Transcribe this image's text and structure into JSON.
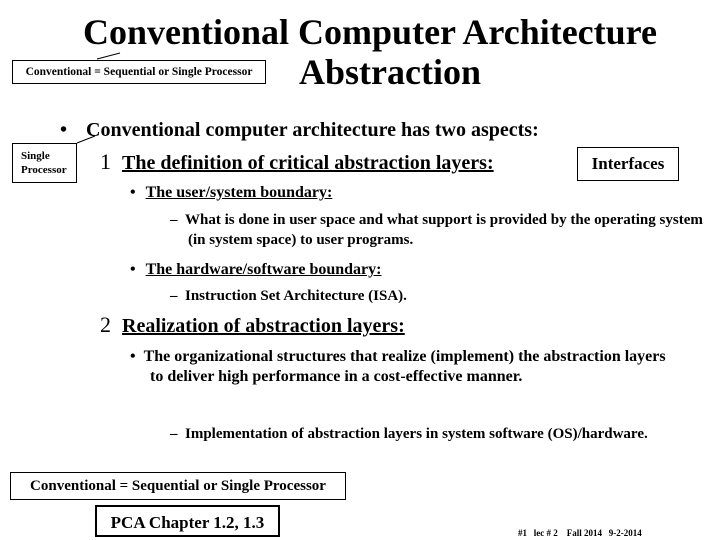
{
  "slide": {
    "title_line1": "Conventional Computer Architecture",
    "title_line2": "Abstraction",
    "callout_top": "Conventional = Sequential or Single Processor",
    "callout_left_line1": "Single",
    "callout_left_line2": "Processor",
    "interfaces_label": "Interfaces",
    "bullet_main": "Conventional computer architecture has two aspects:",
    "aspect1_num": "1",
    "aspect1_title": "The definition of critical abstraction layers:",
    "aspect1_sub1": "The user/system boundary:",
    "aspect1_sub1_detail": "What is done in user space and what support is provided by the operating system (in system space) to user programs.",
    "aspect1_sub2": "The hardware/software boundary:",
    "aspect1_sub2_detail": "Instruction Set Architecture (ISA).",
    "aspect2_num": "2",
    "aspect2_title": "Realization of abstraction layers:",
    "aspect2_sub1": "The organizational structures that realize (implement) the abstraction layers to deliver high performance in a cost-effective manner.",
    "aspect2_sub1_detail": "Implementation of abstraction layers in system software (OS)/hardware.",
    "bottom_box": "Conventional = Sequential or Single Processor",
    "pca_box": "PCA Chapter 1.2, 1.3",
    "footer": "#1   lec # 2    Fall 2014   9-2-2014"
  }
}
